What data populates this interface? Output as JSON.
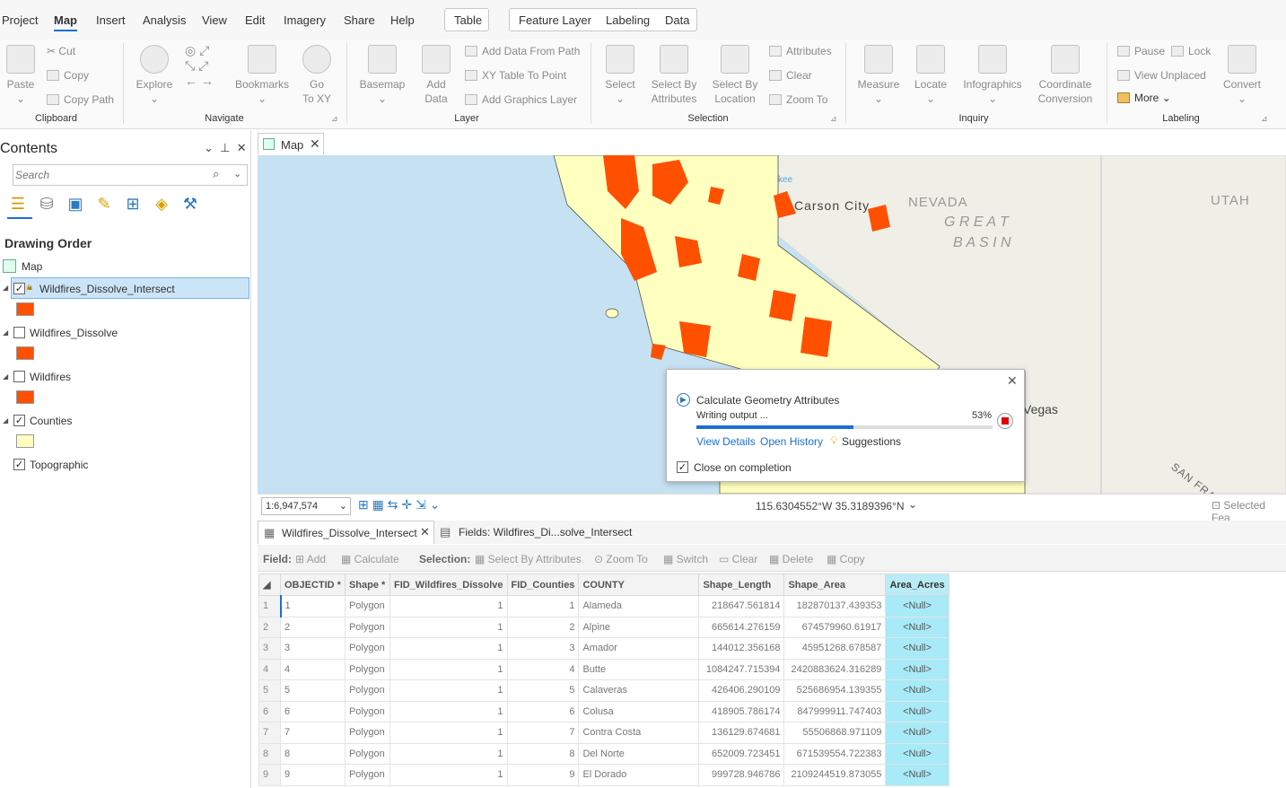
{
  "menubar": {
    "items": [
      "Project",
      "Map",
      "Insert",
      "Analysis",
      "View",
      "Edit",
      "Imagery",
      "Share",
      "Help"
    ],
    "active": "Map",
    "context_table": "Table",
    "context_feature": [
      "Feature Layer",
      "Labeling",
      "Data"
    ]
  },
  "ribbon": {
    "clipboard": {
      "paste": "Paste",
      "cut": "Cut",
      "copy": "Copy",
      "copy_path": "Copy Path",
      "group": "Clipboard"
    },
    "navigate": {
      "explore": "Explore",
      "bookmarks": "Bookmarks",
      "goto": "Go\nTo XY",
      "group": "Navigate"
    },
    "layer": {
      "basemap": "Basemap",
      "add_data": "Add\nData",
      "add_data_path": "Add Data From Path",
      "xy_table": "XY Table To Point",
      "add_graphics": "Add Graphics Layer",
      "group": "Layer"
    },
    "selection": {
      "select": "Select",
      "select_by_attr": "Select By\nAttributes",
      "select_by_loc": "Select By\nLocation",
      "attributes": "Attributes",
      "clear": "Clear",
      "zoom_to": "Zoom To",
      "group": "Selection"
    },
    "inquiry": {
      "measure": "Measure",
      "locate": "Locate",
      "infographics": "Infographics",
      "coord_conv": "Coordinate\nConversion",
      "group": "Inquiry"
    },
    "labeling": {
      "pause": "Pause",
      "lock": "Lock",
      "view_unplaced": "View Unplaced",
      "more": "More",
      "convert": "Convert",
      "group": "Labeling"
    }
  },
  "contents": {
    "title": "Contents",
    "search_placeholder": "Search",
    "drawing_order": "Drawing Order",
    "map_label": "Map",
    "layers": [
      {
        "name": "Wildfires_Dissolve_Intersect",
        "checked": true,
        "color": "#ff5000"
      },
      {
        "name": "Wildfires_Dissolve",
        "checked": false,
        "color": "#ff5000"
      },
      {
        "name": "Wildfires",
        "checked": false,
        "color": "#ff5000"
      },
      {
        "name": "Counties",
        "checked": true,
        "color": "#ffffbf"
      },
      {
        "name": "Topographic",
        "checked": true
      }
    ]
  },
  "map": {
    "tab": "Map",
    "labels": {
      "carson": "Carson City",
      "nevada": "NEVADA",
      "great": "G R E A T",
      "basin": "B A S I N",
      "utah": "UTAH",
      "vegas": "Vegas",
      "sanfra": "SAN FRA",
      "kee": "kee"
    },
    "scale": "1:6,947,574",
    "coords": "115.6304552°W 35.3189396°N",
    "selected": "Selected Fea"
  },
  "popup": {
    "title": "Calculate Geometry Attributes",
    "status": "Writing output ...",
    "percent": "53%",
    "progress": 0.53,
    "view_details": "View Details",
    "open_history": "Open History",
    "suggestions": "Suggestions",
    "close_on_completion": "Close on completion"
  },
  "table": {
    "tab": "Wildfires_Dissolve_Intersect",
    "fields_tab": "Fields: Wildfires_Di...solve_Intersect",
    "toolbar": {
      "field": "Field:",
      "add": "Add",
      "calculate": "Calculate",
      "selection": "Selection:",
      "select_by_attr": "Select By Attributes",
      "zoom_to": "Zoom To",
      "switch": "Switch",
      "clear": "Clear",
      "delete": "Delete",
      "copy": "Copy"
    },
    "columns": [
      "OBJECTID *",
      "Shape *",
      "FID_Wildfires_Dissolve",
      "FID_Counties",
      "COUNTY",
      "Shape_Length",
      "Shape_Area",
      "Area_Acres"
    ],
    "rows": [
      [
        "1",
        "1",
        "Polygon",
        "1",
        "1",
        "Alameda",
        "218647.561814",
        "182870137.439353",
        "<Null>"
      ],
      [
        "2",
        "2",
        "Polygon",
        "1",
        "2",
        "Alpine",
        "665614.276159",
        "674579960.61917",
        "<Null>"
      ],
      [
        "3",
        "3",
        "Polygon",
        "1",
        "3",
        "Amador",
        "144012.356168",
        "45951268.678587",
        "<Null>"
      ],
      [
        "4",
        "4",
        "Polygon",
        "1",
        "4",
        "Butte",
        "1084247.715394",
        "2420883624.316289",
        "<Null>"
      ],
      [
        "5",
        "5",
        "Polygon",
        "1",
        "5",
        "Calaveras",
        "426406.290109",
        "525686954.139355",
        "<Null>"
      ],
      [
        "6",
        "6",
        "Polygon",
        "1",
        "6",
        "Colusa",
        "418905.786174",
        "847999911.747403",
        "<Null>"
      ],
      [
        "7",
        "7",
        "Polygon",
        "1",
        "7",
        "Contra Costa",
        "136129.674681",
        "55506868.971109",
        "<Null>"
      ],
      [
        "8",
        "8",
        "Polygon",
        "1",
        "8",
        "Del Norte",
        "652009.723451",
        "671539554.722383",
        "<Null>"
      ],
      [
        "9",
        "9",
        "Polygon",
        "1",
        "9",
        "El Dorado",
        "999728.946786",
        "2109244519.873055",
        "<Null>"
      ]
    ]
  }
}
